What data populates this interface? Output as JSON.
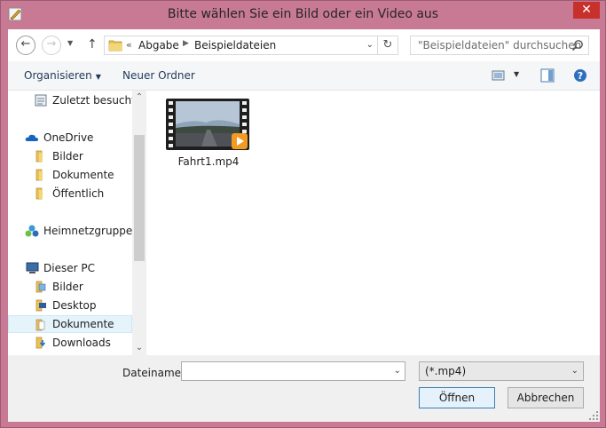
{
  "window": {
    "title": "Bitte wählen Sie ein Bild oder ein Video aus",
    "close_label": "✕"
  },
  "nav": {
    "breadcrumb_overflow": "«",
    "breadcrumbs": [
      "Abgabe",
      "Beispieldateien"
    ],
    "search_placeholder": "\"Beispieldateien\" durchsuchen"
  },
  "toolbar": {
    "organize_label": "Organisieren",
    "new_folder_label": "Neuer Ordner"
  },
  "sidebar": {
    "items": [
      {
        "label": "Zuletzt besucht",
        "icon": "recent-places-icon"
      },
      {
        "label": "OneDrive",
        "icon": "onedrive-cloud-icon"
      },
      {
        "label": "Bilder",
        "icon": "folder-icon"
      },
      {
        "label": "Dokumente",
        "icon": "folder-icon"
      },
      {
        "label": "Öffentlich",
        "icon": "folder-icon"
      },
      {
        "label": "Heimnetzgruppe",
        "icon": "homegroup-icon"
      },
      {
        "label": "Dieser PC",
        "icon": "computer-icon"
      },
      {
        "label": "Bilder",
        "icon": "pictures-library-icon"
      },
      {
        "label": "Desktop",
        "icon": "desktop-folder-icon"
      },
      {
        "label": "Dokumente",
        "icon": "documents-library-icon"
      },
      {
        "label": "Downloads",
        "icon": "downloads-folder-icon"
      }
    ],
    "selected_index": 9
  },
  "files": [
    {
      "name": "Fahrt1.mp4",
      "icon": "video-file-icon"
    }
  ],
  "bottom": {
    "filename_label": "Dateiname:",
    "filename_value": "",
    "filter_value": "(*.mp4)",
    "open_label": "Öffnen",
    "cancel_label": "Abbrechen"
  },
  "colors": {
    "frame": "#c87a94",
    "close": "#c7302b",
    "accent": "#1e395b",
    "selection": "#e5f3fb"
  }
}
